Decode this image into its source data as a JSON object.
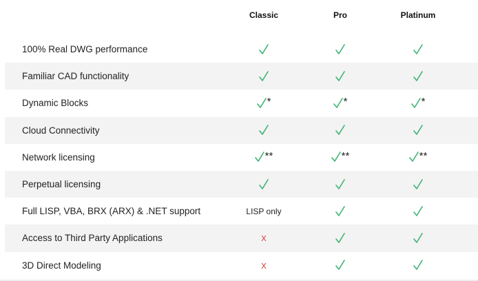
{
  "colors": {
    "check": "#3cb371",
    "cross": "#d9534f",
    "alt_row_bg": "#f3f3f3"
  },
  "columns": [
    {
      "label": "Classic"
    },
    {
      "label": "Pro"
    },
    {
      "label": "Platinum"
    }
  ],
  "rows": [
    {
      "feature": "100% Real DWG performance",
      "cells": [
        {
          "type": "check",
          "suffix": ""
        },
        {
          "type": "check",
          "suffix": ""
        },
        {
          "type": "check",
          "suffix": ""
        }
      ]
    },
    {
      "feature": "Familiar CAD functionality",
      "cells": [
        {
          "type": "check",
          "suffix": ""
        },
        {
          "type": "check",
          "suffix": ""
        },
        {
          "type": "check",
          "suffix": ""
        }
      ]
    },
    {
      "feature": "Dynamic Blocks",
      "cells": [
        {
          "type": "check",
          "suffix": "*"
        },
        {
          "type": "check",
          "suffix": "*"
        },
        {
          "type": "check",
          "suffix": "*"
        }
      ]
    },
    {
      "feature": "Cloud Connectivity",
      "cells": [
        {
          "type": "check",
          "suffix": ""
        },
        {
          "type": "check",
          "suffix": ""
        },
        {
          "type": "check",
          "suffix": ""
        }
      ]
    },
    {
      "feature": "Network licensing",
      "cells": [
        {
          "type": "check",
          "suffix": "**"
        },
        {
          "type": "check",
          "suffix": "**"
        },
        {
          "type": "check",
          "suffix": "**"
        }
      ]
    },
    {
      "feature": "Perpetual licensing",
      "cells": [
        {
          "type": "check",
          "suffix": ""
        },
        {
          "type": "check",
          "suffix": ""
        },
        {
          "type": "check",
          "suffix": ""
        }
      ]
    },
    {
      "feature": "Full LISP, VBA, BRX (ARX) & .NET support",
      "cells": [
        {
          "type": "text",
          "text": "LISP only"
        },
        {
          "type": "check",
          "suffix": ""
        },
        {
          "type": "check",
          "suffix": ""
        }
      ]
    },
    {
      "feature": "Access to Third Party Applications",
      "cells": [
        {
          "type": "cross",
          "text": "x"
        },
        {
          "type": "check",
          "suffix": ""
        },
        {
          "type": "check",
          "suffix": ""
        }
      ]
    },
    {
      "feature": "3D Direct Modeling",
      "cells": [
        {
          "type": "cross",
          "text": "x"
        },
        {
          "type": "check",
          "suffix": ""
        },
        {
          "type": "check",
          "suffix": ""
        }
      ]
    }
  ]
}
